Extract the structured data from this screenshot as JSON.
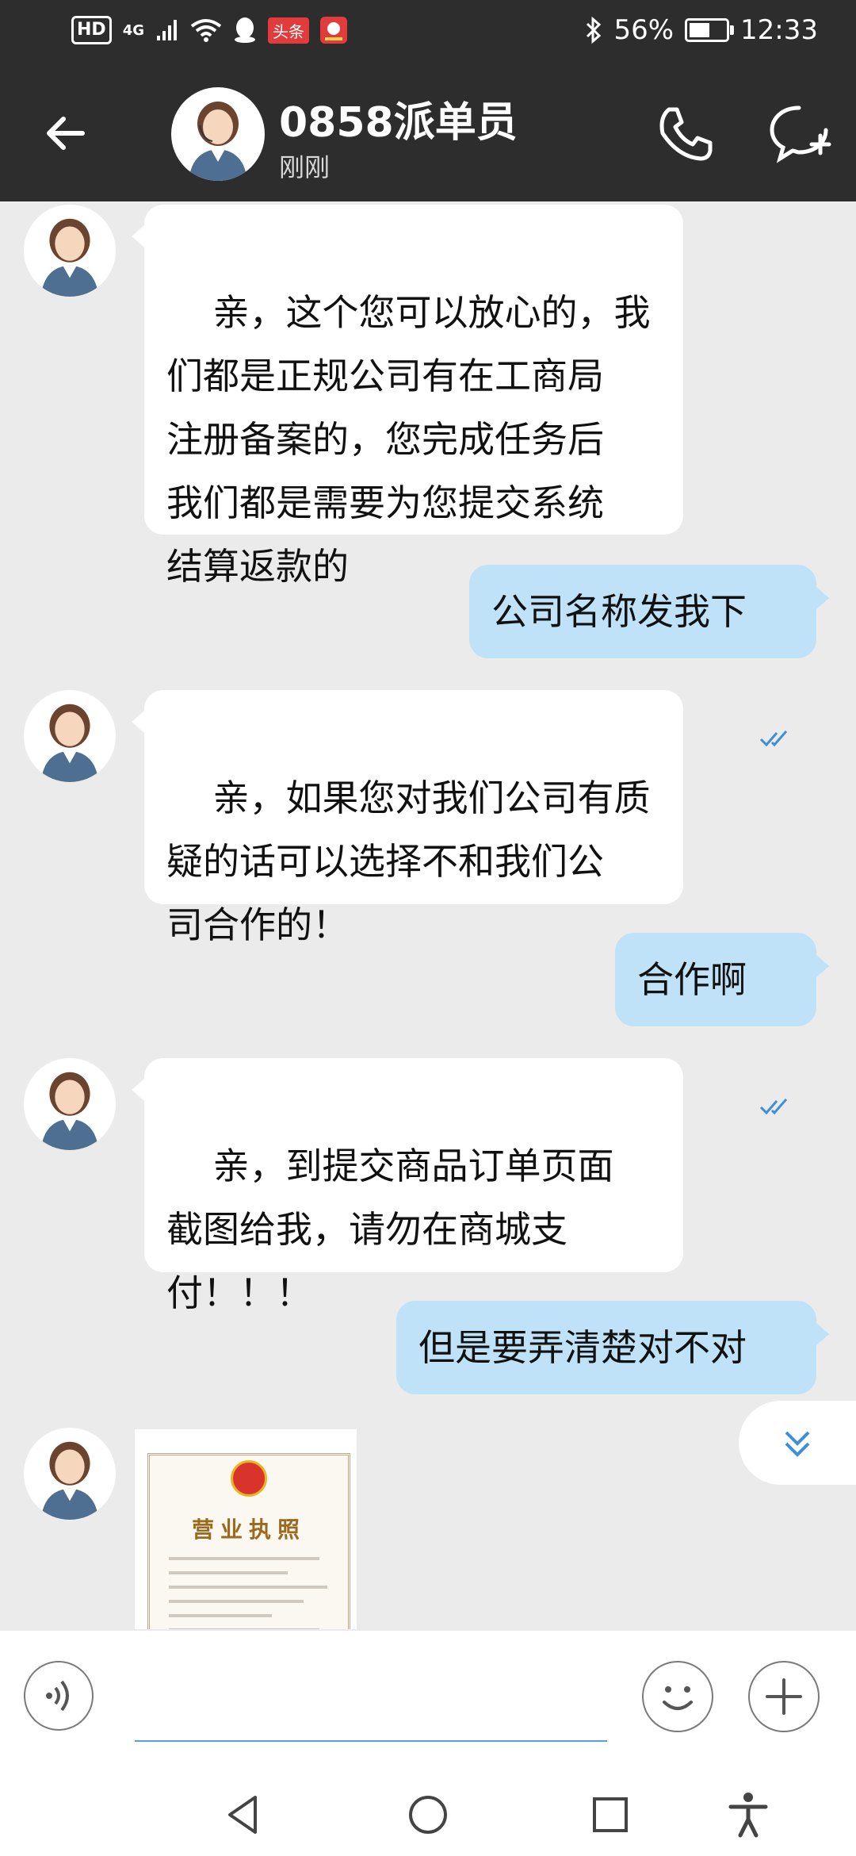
{
  "status_bar": {
    "left_badges": [
      "HD",
      "4G",
      "头条"
    ],
    "battery": "56%",
    "battery_level": 0.56,
    "time": "12:33",
    "icons": [
      "hd-icon",
      "signal-icon",
      "wifi-icon",
      "qq-icon",
      "toutiao-icon",
      "app-icon",
      "bluetooth-icon",
      "battery-icon"
    ]
  },
  "header": {
    "contact_name": "0858派单员",
    "contact_status": "刚刚",
    "icons": [
      "back-arrow-icon",
      "phone-icon",
      "add-chat-icon"
    ]
  },
  "colors": {
    "header_bg": "#2d2d2d",
    "chat_bg": "#ebebeb",
    "incoming_bubble": "#ffffff",
    "outgoing_bubble": "#bfe2f8",
    "read_tick": "#3f8fd8"
  },
  "messages": [
    {
      "direction": "incoming",
      "text": "亲，这个您可以放心的，我\n们都是正规公司有在工商局\n注册备案的，您完成任务后\n我们都是需要为您提交系统\n结算返款的"
    },
    {
      "direction": "outgoing",
      "text": "公司名称发我下",
      "status_icon": "read-double-tick-icon"
    },
    {
      "direction": "incoming",
      "text": "亲，如果您对我们公司有质\n疑的话可以选择不和我们公\n司合作的！"
    },
    {
      "direction": "outgoing",
      "text": "合作啊",
      "status_icon": "read-double-tick-icon"
    },
    {
      "direction": "incoming",
      "text": "亲，到提交商品订单页面\n截图给我，请勿在商城支\n付！！！"
    },
    {
      "direction": "outgoing",
      "text": "但是要弄清楚对不对",
      "status_icon": "read-double-tick-icon"
    }
  ],
  "image_message": {
    "direction": "incoming",
    "title": "营业执照",
    "icon": "business-license-image"
  },
  "input_bar": {
    "icons": [
      "voice-icon",
      "emoji-icon",
      "plus-icon"
    ],
    "text_value": ""
  },
  "nav_bar": {
    "icons": [
      "nav-back-icon",
      "nav-home-icon",
      "nav-recents-icon",
      "accessibility-icon"
    ]
  }
}
